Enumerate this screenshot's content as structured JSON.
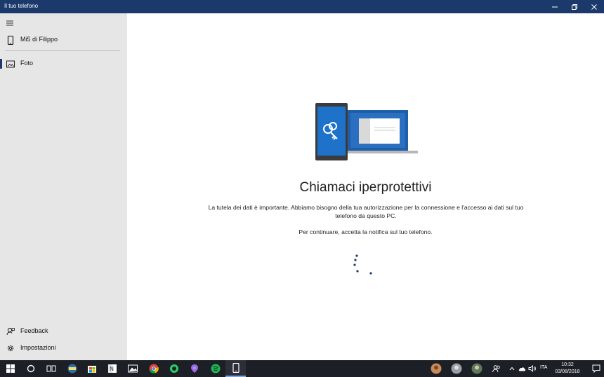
{
  "window": {
    "title": "Il tuo telefono"
  },
  "sidebar": {
    "device_label": "Mi5 di Filippo",
    "items": [
      {
        "label": "Foto",
        "icon": "photos-icon",
        "selected": true
      }
    ],
    "footer": [
      {
        "label": "Feedback",
        "icon": "feedback-icon"
      },
      {
        "label": "Impostazioni",
        "icon": "gear-icon"
      }
    ]
  },
  "main": {
    "heading": "Chiamaci iperprotettivi",
    "body_1": "La tutela dei dati è importante. Abbiamo bisogno della tua autorizzazione per la connessione e l'accesso ai dati sul tuo telefono da questo PC.",
    "body_2": "Per continuare, accetta la notifica sul tuo telefono."
  },
  "taskbar": {
    "apps": [
      "start-icon",
      "cortana-icon",
      "task-view-icon",
      "app-icon",
      "store-icon",
      "onenote-icon",
      "photos-icon",
      "chrome-icon",
      "whatsapp-icon",
      "maps-icon",
      "spotify-icon",
      "your-phone-icon"
    ],
    "active_app": "your-phone-icon",
    "language": "ITA",
    "time": "10:32",
    "date": "03/08/2018"
  },
  "colors": {
    "titlebar": "#1b3a6b",
    "sidebar": "#e6e6e6",
    "accent": "#1b3a6b",
    "taskbar": "#1d1f26"
  }
}
